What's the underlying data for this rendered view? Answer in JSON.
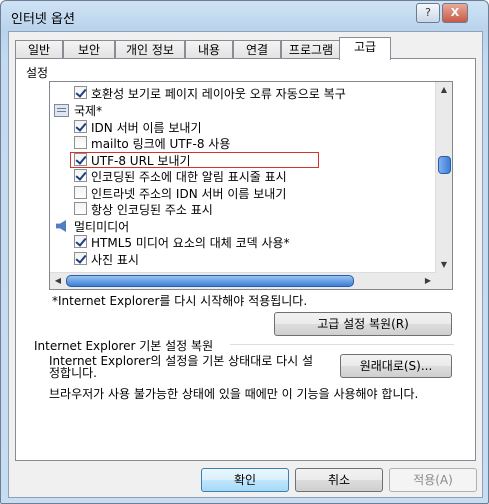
{
  "window": {
    "title": "인터넷 옵션"
  },
  "tabs": [
    {
      "label": "일반"
    },
    {
      "label": "보안"
    },
    {
      "label": "개인 정보"
    },
    {
      "label": "내용"
    },
    {
      "label": "연결"
    },
    {
      "label": "프로그램"
    },
    {
      "label": "고급"
    }
  ],
  "active_tab": "고급",
  "settings": {
    "label": "설정",
    "items": [
      {
        "text": "호환성 보기로 페이지 레이아웃 오류 자동으로 복구",
        "type": "checkbox",
        "checked": true
      },
      {
        "text": "국제*",
        "type": "category",
        "icon": "settings-category-icon"
      },
      {
        "text": "IDN 서버 이름 보내기",
        "type": "checkbox",
        "checked": true
      },
      {
        "text": "mailto 링크에 UTF-8 사용",
        "type": "checkbox",
        "checked": false
      },
      {
        "text": "UTF-8 URL 보내기",
        "type": "checkbox",
        "checked": true
      },
      {
        "text": "인코딩된 주소에 대한 알림 표시줄 표시",
        "type": "checkbox",
        "checked": true
      },
      {
        "text": "인트라넷 주소의 IDN 서버 이름 보내기",
        "type": "checkbox",
        "checked": false
      },
      {
        "text": "항상 인코딩된 주소 표시",
        "type": "checkbox",
        "checked": false
      },
      {
        "text": "멀티미디어",
        "type": "category",
        "icon": "multimedia-icon"
      },
      {
        "text": "HTML5 미디어 요소의 대체 코덱 사용*",
        "type": "checkbox",
        "checked": true
      },
      {
        "text": "사진 표시",
        "type": "checkbox",
        "checked": true
      }
    ],
    "restart_note": "*Internet Explorer를 다시 시작해야 적용됩니다.",
    "restore_advanced_button": "고급 설정 복원(R)"
  },
  "reset": {
    "group_label": "Internet Explorer 기본 설정 복원",
    "description_line1": "Internet Explorer의 설정을 기본 상태대로 다시 설",
    "description_line2": "정합니다.",
    "reset_button": "원래대로(S)...",
    "warning": "브라우저가 사용 불가능한 상태에 있을 때에만 이 기능을 사용해야 합니다."
  },
  "footer": {
    "ok": "확인",
    "cancel": "취소",
    "apply": "적용(A)"
  },
  "titlebar_buttons": {
    "help": "?",
    "close": "X"
  }
}
